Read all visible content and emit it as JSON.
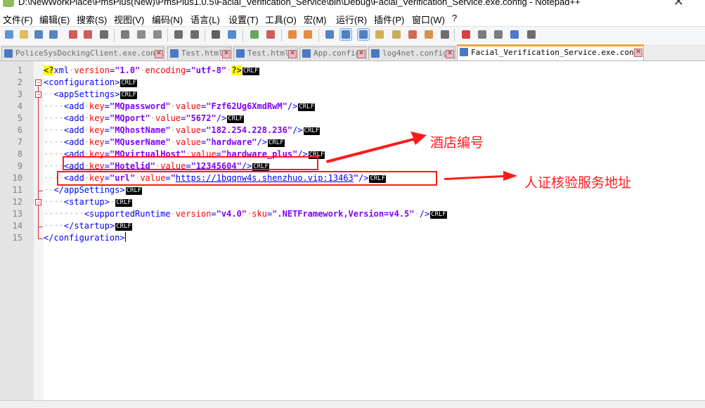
{
  "window": {
    "title": "D:\\NewWorkPlace\\PmsPlus(New)\\PmsPlus1.0.5\\Facial_Verification_Service\\bin\\Debug\\Facial_Verification_Service.exe.config - Notepad++",
    "close_glyph": "✕"
  },
  "menu": [
    "文件(F)",
    "编辑(E)",
    "搜索(S)",
    "视图(V)",
    "编码(N)",
    "语言(L)",
    "设置(T)",
    "工具(O)",
    "宏(M)",
    "运行(R)",
    "插件(P)",
    "窗口(W)",
    "?"
  ],
  "toolbar_icons": [
    "new-file-icon",
    "open-file-icon",
    "save-icon",
    "save-all-icon",
    "close-icon",
    "close-all-icon",
    "print-icon",
    "cut-icon",
    "copy-icon",
    "paste-icon",
    "undo-icon",
    "redo-icon",
    "find-icon",
    "replace-icon",
    "zoom-in-icon",
    "zoom-out-icon",
    "sync-vertical-icon",
    "sync-horizontal-icon",
    "word-wrap-icon",
    "show-all-chars-icon",
    "indent-guide-icon",
    "language-icon",
    "doc-map-icon",
    "function-list-icon",
    "folder-workspace-icon",
    "monitor-icon",
    "record-macro-icon",
    "stop-record-icon",
    "play-macro-icon",
    "run-macro-multiple-icon",
    "save-macro-icon"
  ],
  "tabs": [
    {
      "label": "PoliceSysDockingClient.exe.config",
      "active": false
    },
    {
      "label": "Test.html",
      "active": false
    },
    {
      "label": "Test.html",
      "active": false
    },
    {
      "label": "App.config",
      "active": false
    },
    {
      "label": "log4net.config",
      "active": false
    },
    {
      "label": "Facial_Verification_Service.exe.config",
      "active": true
    }
  ],
  "tab_close_glyph": "✕",
  "eol_marker": "CRLF",
  "lines": [
    {
      "n": "1",
      "ws": "",
      "parts": [
        [
          "decl",
          "<?"
        ],
        [
          "tag",
          "xml"
        ],
        [
          "ws",
          "·"
        ],
        [
          "attr",
          "version"
        ],
        [
          "tag",
          "="
        ],
        [
          "val",
          "\"1.0\""
        ],
        [
          "ws",
          "·"
        ],
        [
          "attr",
          "encoding"
        ],
        [
          "tag",
          "="
        ],
        [
          "val",
          "\"utf-8\""
        ],
        [
          "ws",
          "·"
        ],
        [
          "decl",
          "?>"
        ]
      ]
    },
    {
      "n": "2",
      "ws": "",
      "parts": [
        [
          "tag",
          "<configuration>"
        ]
      ]
    },
    {
      "n": "3",
      "ws": "··",
      "parts": [
        [
          "tag",
          "<appSettings>"
        ]
      ]
    },
    {
      "n": "4",
      "ws": "····",
      "parts": [
        [
          "tag",
          "<add"
        ],
        [
          "ws",
          "·"
        ],
        [
          "attr",
          "key"
        ],
        [
          "tag",
          "="
        ],
        [
          "val",
          "\"MQpassword\""
        ],
        [
          "ws",
          "·"
        ],
        [
          "attr",
          "value"
        ],
        [
          "tag",
          "="
        ],
        [
          "val",
          "\"Fzf62Ug6XmdRwM\""
        ],
        [
          "tag",
          "/>"
        ]
      ]
    },
    {
      "n": "5",
      "ws": "····",
      "parts": [
        [
          "tag",
          "<add"
        ],
        [
          "ws",
          "·"
        ],
        [
          "attr",
          "key"
        ],
        [
          "tag",
          "="
        ],
        [
          "val",
          "\"MQport\""
        ],
        [
          "ws",
          "·"
        ],
        [
          "attr",
          "value"
        ],
        [
          "tag",
          "="
        ],
        [
          "val",
          "\"5672\""
        ],
        [
          "tag",
          "/>"
        ]
      ]
    },
    {
      "n": "6",
      "ws": "····",
      "parts": [
        [
          "tag",
          "<add"
        ],
        [
          "ws",
          "·"
        ],
        [
          "attr",
          "key"
        ],
        [
          "tag",
          "="
        ],
        [
          "val",
          "\"MQhostName\""
        ],
        [
          "ws",
          "·"
        ],
        [
          "attr",
          "value"
        ],
        [
          "tag",
          "="
        ],
        [
          "val",
          "\"182.254.228.236\""
        ],
        [
          "tag",
          "/>"
        ]
      ]
    },
    {
      "n": "7",
      "ws": "····",
      "parts": [
        [
          "tag",
          "<add"
        ],
        [
          "ws",
          "·"
        ],
        [
          "attr",
          "key"
        ],
        [
          "tag",
          "="
        ],
        [
          "val",
          "\"MQuserName\""
        ],
        [
          "ws",
          "·"
        ],
        [
          "attr",
          "value"
        ],
        [
          "tag",
          "="
        ],
        [
          "val",
          "\"hardware\""
        ],
        [
          "tag",
          "/>"
        ]
      ]
    },
    {
      "n": "8",
      "ws": "····",
      "parts": [
        [
          "tag",
          "<add"
        ],
        [
          "ws",
          "·"
        ],
        [
          "attr",
          "key"
        ],
        [
          "tag",
          "="
        ],
        [
          "val",
          "\"MQvirtualHost\""
        ],
        [
          "ws",
          "·"
        ],
        [
          "attr",
          "value"
        ],
        [
          "tag",
          "="
        ],
        [
          "val",
          "\"hardware_plus\""
        ],
        [
          "tag",
          "/>"
        ]
      ]
    },
    {
      "n": "9",
      "ws": "····",
      "parts": [
        [
          "tag",
          "<add"
        ],
        [
          "ws",
          "·"
        ],
        [
          "attr",
          "key"
        ],
        [
          "tag",
          "="
        ],
        [
          "val",
          "\"Hotelid\""
        ],
        [
          "ws",
          "·"
        ],
        [
          "attr",
          "value"
        ],
        [
          "tag",
          "="
        ],
        [
          "val",
          "\"12345604\""
        ],
        [
          "tag",
          "/>"
        ]
      ]
    },
    {
      "n": "10",
      "ws": "····",
      "parts": [
        [
          "tag",
          "<add"
        ],
        [
          "ws",
          "·"
        ],
        [
          "attr",
          "key"
        ],
        [
          "tag",
          "="
        ],
        [
          "val",
          "\"url\""
        ],
        [
          "ws",
          "·"
        ],
        [
          "attr",
          "value"
        ],
        [
          "tag",
          "="
        ],
        [
          "val",
          "\""
        ],
        [
          "url",
          "https://1bqqnw4s.shenzhuo.vip:13463"
        ],
        [
          "val",
          "\""
        ],
        [
          "tag",
          "/>"
        ]
      ]
    },
    {
      "n": "11",
      "ws": "··",
      "parts": [
        [
          "tag",
          "</appSettings>"
        ]
      ]
    },
    {
      "n": "12",
      "ws": "····",
      "parts": [
        [
          "tag",
          "<startup>"
        ],
        [
          "ws",
          "·"
        ]
      ]
    },
    {
      "n": "13",
      "ws": "········",
      "parts": [
        [
          "tag",
          "<supportedRuntime"
        ],
        [
          "ws",
          "·"
        ],
        [
          "attr",
          "version"
        ],
        [
          "tag",
          "="
        ],
        [
          "val",
          "\"v4.0\""
        ],
        [
          "ws",
          "·"
        ],
        [
          "attr",
          "sku"
        ],
        [
          "tag",
          "="
        ],
        [
          "val",
          "\".NETFramework,Version=v4.5\""
        ],
        [
          "ws",
          "·"
        ],
        [
          "tag",
          "/>"
        ]
      ]
    },
    {
      "n": "14",
      "ws": "····",
      "parts": [
        [
          "tag",
          "</startup>"
        ]
      ]
    },
    {
      "n": "15",
      "ws": "",
      "parts": [
        [
          "tag",
          "</configuration>"
        ]
      ],
      "no_eol": true,
      "current": true
    }
  ],
  "annotations": [
    {
      "label": "酒店编号"
    },
    {
      "label": "人证核验服务地址"
    }
  ],
  "colors": {
    "annotation_red": "#ff1a1a",
    "tag_blue": "#0000ff",
    "attr_red": "#ff0000",
    "value_purple": "#8000ff",
    "active_tab_accent": "#f9a23a"
  }
}
